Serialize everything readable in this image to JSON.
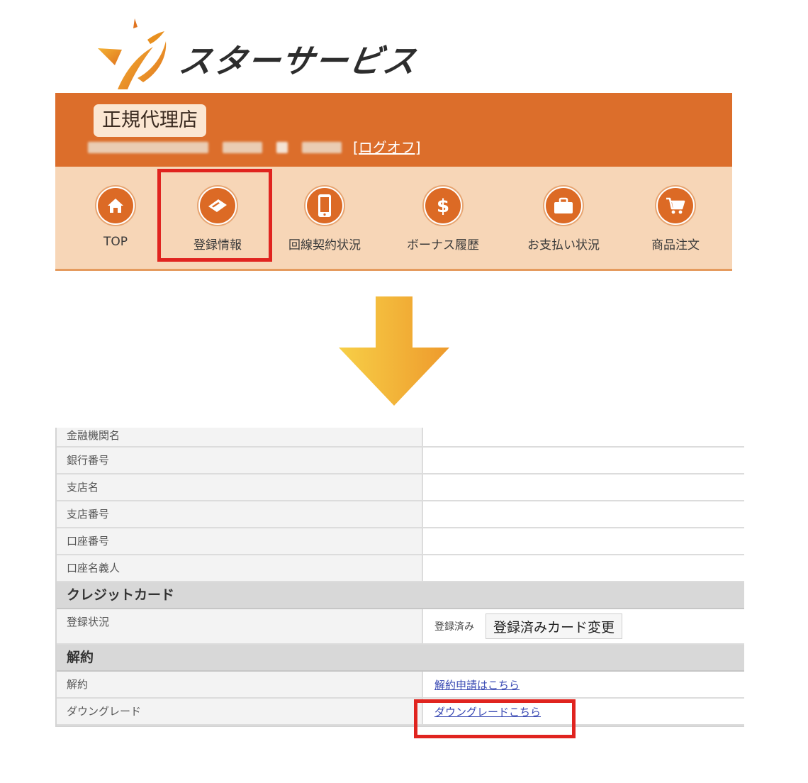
{
  "logo": {
    "brand_text": "スターサービス",
    "mark_icon": "star-swoosh-icon"
  },
  "header": {
    "agency_badge": "正規代理店",
    "logoff_link": "[ログオフ]"
  },
  "nav": {
    "items": [
      {
        "label": "TOP",
        "icon": "home-icon"
      },
      {
        "label": "登録情報",
        "icon": "card-icon"
      },
      {
        "label": "回線契約状況",
        "icon": "smartphone-icon"
      },
      {
        "label": "ボーナス履歴",
        "icon": "dollar-icon"
      },
      {
        "label": "お支払い状況",
        "icon": "briefcase-icon"
      },
      {
        "label": "商品注文",
        "icon": "cart-icon"
      }
    ]
  },
  "table": {
    "bank_rows": [
      {
        "label": "金融機関名"
      },
      {
        "label": "銀行番号"
      },
      {
        "label": "支店名"
      },
      {
        "label": "支店番号"
      },
      {
        "label": "口座番号"
      },
      {
        "label": "口座名義人"
      }
    ],
    "credit_section": "クレジットカード",
    "credit_row": {
      "label": "登録状況",
      "status": "登録済み",
      "button": "登録済みカード変更"
    },
    "cancel_section": "解約",
    "cancel_row": {
      "label": "解約",
      "link": "解約申請はこちら"
    },
    "downgrade_row": {
      "label": "ダウングレード",
      "link": "ダウングレードこちら"
    }
  },
  "colors": {
    "brand_orange": "#dc6e2b",
    "nav_bg": "#f7d6b7",
    "highlight_red": "#e0241f",
    "link_blue": "#3b4bb4"
  }
}
